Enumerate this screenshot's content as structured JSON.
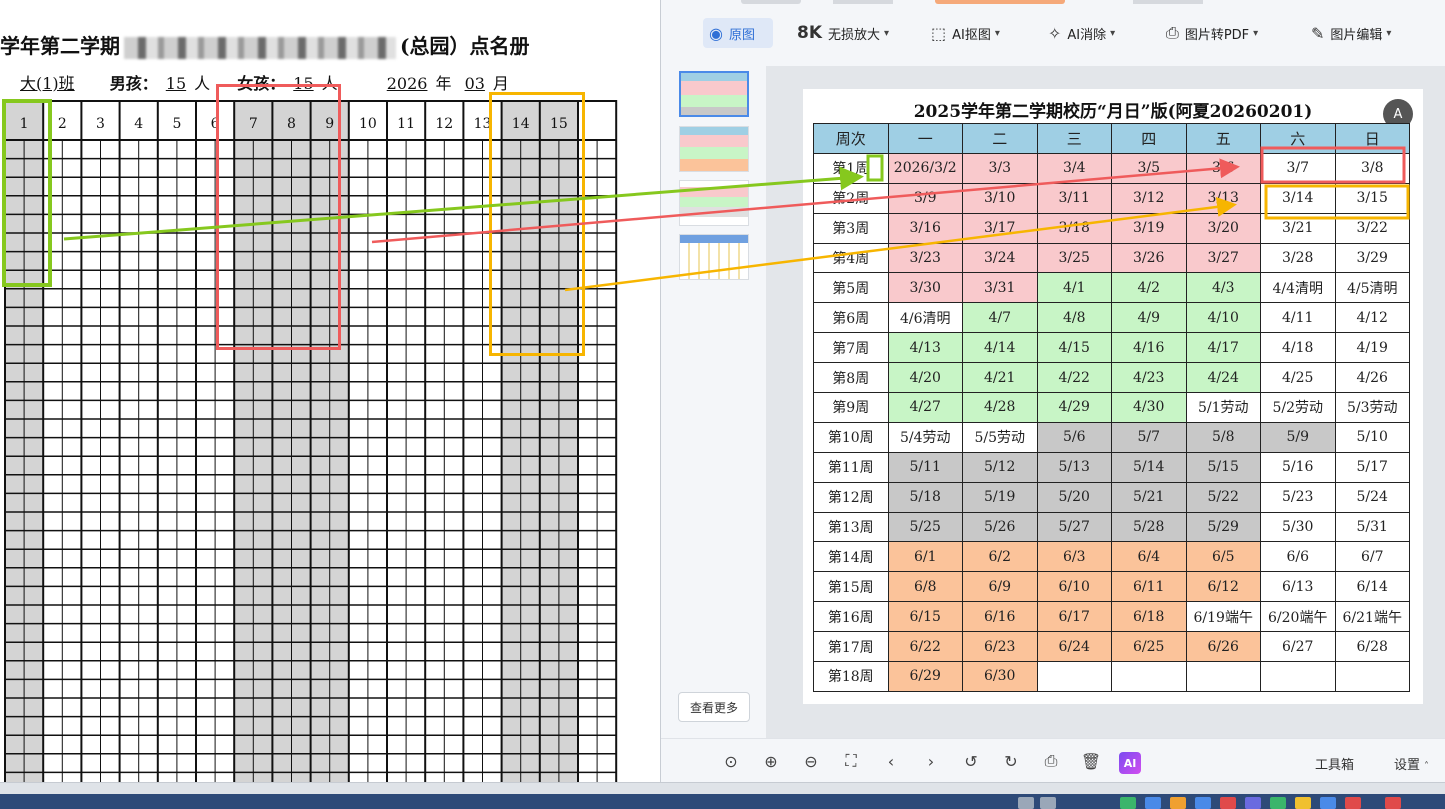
{
  "document": {
    "title_prefix": "学年第二学期",
    "title_suffix": "(总园）点名册",
    "class_name": "大(1)班",
    "boys_label": "男孩：",
    "boys_count": "15",
    "girls_label": "女孩：",
    "girls_count": "15",
    "person_unit": "人",
    "year": "2026",
    "year_unit": "年",
    "month": "03",
    "month_unit": "月",
    "day_headers": [
      "1",
      "2",
      "3",
      "4",
      "5",
      "6",
      "7",
      "8",
      "9",
      "10",
      "11",
      "12",
      "13",
      "14",
      "15"
    ],
    "shaded_columns": [
      1,
      7,
      8,
      9,
      14,
      15
    ],
    "highlight_colors": {
      "green": "#86c81e",
      "red": "#ef5b5b",
      "yellow": "#f7b500"
    }
  },
  "toolbar": {
    "original": "原图",
    "enlarge": "无损放大",
    "enlarge_icon_text": "8K",
    "cutout": "AI抠图",
    "erase": "AI消除",
    "to_pdf": "图片转PDF",
    "edit": "图片编辑"
  },
  "sidebar": {
    "more": "查看更多"
  },
  "calendar": {
    "title": "2025学年第二学期校历“月日”版(阿夏20260201)",
    "ocr_icon": "A",
    "headers": [
      "周次",
      "一",
      "二",
      "三",
      "四",
      "五",
      "六",
      "日"
    ],
    "rows": [
      {
        "week": "第1周",
        "cells": [
          {
            "t": "2026/3/2",
            "c": "pink"
          },
          {
            "t": "3/3",
            "c": "pink"
          },
          {
            "t": "3/4",
            "c": "pink"
          },
          {
            "t": "3/5",
            "c": "pink"
          },
          {
            "t": "3/6",
            "c": "pink"
          },
          {
            "t": "3/7",
            "c": "white"
          },
          {
            "t": "3/8",
            "c": "white"
          }
        ]
      },
      {
        "week": "第2周",
        "cells": [
          {
            "t": "3/9",
            "c": "pink"
          },
          {
            "t": "3/10",
            "c": "pink"
          },
          {
            "t": "3/11",
            "c": "pink"
          },
          {
            "t": "3/12",
            "c": "pink"
          },
          {
            "t": "3/13",
            "c": "pink"
          },
          {
            "t": "3/14",
            "c": "white"
          },
          {
            "t": "3/15",
            "c": "white"
          }
        ]
      },
      {
        "week": "第3周",
        "cells": [
          {
            "t": "3/16",
            "c": "pink"
          },
          {
            "t": "3/17",
            "c": "pink"
          },
          {
            "t": "3/18",
            "c": "pink"
          },
          {
            "t": "3/19",
            "c": "pink"
          },
          {
            "t": "3/20",
            "c": "pink"
          },
          {
            "t": "3/21",
            "c": "white"
          },
          {
            "t": "3/22",
            "c": "white"
          }
        ]
      },
      {
        "week": "第4周",
        "cells": [
          {
            "t": "3/23",
            "c": "pink"
          },
          {
            "t": "3/24",
            "c": "pink"
          },
          {
            "t": "3/25",
            "c": "pink"
          },
          {
            "t": "3/26",
            "c": "pink"
          },
          {
            "t": "3/27",
            "c": "pink"
          },
          {
            "t": "3/28",
            "c": "white"
          },
          {
            "t": "3/29",
            "c": "white"
          }
        ]
      },
      {
        "week": "第5周",
        "cells": [
          {
            "t": "3/30",
            "c": "pink"
          },
          {
            "t": "3/31",
            "c": "pink"
          },
          {
            "t": "4/1",
            "c": "green"
          },
          {
            "t": "4/2",
            "c": "green"
          },
          {
            "t": "4/3",
            "c": "green"
          },
          {
            "t": "4/4清明",
            "c": "white"
          },
          {
            "t": "4/5清明",
            "c": "white"
          }
        ]
      },
      {
        "week": "第6周",
        "cells": [
          {
            "t": "4/6清明",
            "c": "white"
          },
          {
            "t": "4/7",
            "c": "green"
          },
          {
            "t": "4/8",
            "c": "green"
          },
          {
            "t": "4/9",
            "c": "green"
          },
          {
            "t": "4/10",
            "c": "green"
          },
          {
            "t": "4/11",
            "c": "white"
          },
          {
            "t": "4/12",
            "c": "white"
          }
        ]
      },
      {
        "week": "第7周",
        "cells": [
          {
            "t": "4/13",
            "c": "green"
          },
          {
            "t": "4/14",
            "c": "green"
          },
          {
            "t": "4/15",
            "c": "green"
          },
          {
            "t": "4/16",
            "c": "green"
          },
          {
            "t": "4/17",
            "c": "green"
          },
          {
            "t": "4/18",
            "c": "white"
          },
          {
            "t": "4/19",
            "c": "white"
          }
        ]
      },
      {
        "week": "第8周",
        "cells": [
          {
            "t": "4/20",
            "c": "green"
          },
          {
            "t": "4/21",
            "c": "green"
          },
          {
            "t": "4/22",
            "c": "green"
          },
          {
            "t": "4/23",
            "c": "green"
          },
          {
            "t": "4/24",
            "c": "green"
          },
          {
            "t": "4/25",
            "c": "white"
          },
          {
            "t": "4/26",
            "c": "white"
          }
        ]
      },
      {
        "week": "第9周",
        "cells": [
          {
            "t": "4/27",
            "c": "green"
          },
          {
            "t": "4/28",
            "c": "green"
          },
          {
            "t": "4/29",
            "c": "green"
          },
          {
            "t": "4/30",
            "c": "green"
          },
          {
            "t": "5/1劳动",
            "c": "white"
          },
          {
            "t": "5/2劳动",
            "c": "white"
          },
          {
            "t": "5/3劳动",
            "c": "white"
          }
        ]
      },
      {
        "week": "第10周",
        "cells": [
          {
            "t": "5/4劳动",
            "c": "white"
          },
          {
            "t": "5/5劳动",
            "c": "white"
          },
          {
            "t": "5/6",
            "c": "gray"
          },
          {
            "t": "5/7",
            "c": "gray"
          },
          {
            "t": "5/8",
            "c": "gray"
          },
          {
            "t": "5/9",
            "c": "gray"
          },
          {
            "t": "5/10",
            "c": "white"
          }
        ]
      },
      {
        "week": "第11周",
        "cells": [
          {
            "t": "5/11",
            "c": "gray"
          },
          {
            "t": "5/12",
            "c": "gray"
          },
          {
            "t": "5/13",
            "c": "gray"
          },
          {
            "t": "5/14",
            "c": "gray"
          },
          {
            "t": "5/15",
            "c": "gray"
          },
          {
            "t": "5/16",
            "c": "white"
          },
          {
            "t": "5/17",
            "c": "white"
          }
        ]
      },
      {
        "week": "第12周",
        "cells": [
          {
            "t": "5/18",
            "c": "gray"
          },
          {
            "t": "5/19",
            "c": "gray"
          },
          {
            "t": "5/20",
            "c": "gray"
          },
          {
            "t": "5/21",
            "c": "gray"
          },
          {
            "t": "5/22",
            "c": "gray"
          },
          {
            "t": "5/23",
            "c": "white"
          },
          {
            "t": "5/24",
            "c": "white"
          }
        ]
      },
      {
        "week": "第13周",
        "cells": [
          {
            "t": "5/25",
            "c": "gray"
          },
          {
            "t": "5/26",
            "c": "gray"
          },
          {
            "t": "5/27",
            "c": "gray"
          },
          {
            "t": "5/28",
            "c": "gray"
          },
          {
            "t": "5/29",
            "c": "gray"
          },
          {
            "t": "5/30",
            "c": "white"
          },
          {
            "t": "5/31",
            "c": "white"
          }
        ]
      },
      {
        "week": "第14周",
        "cells": [
          {
            "t": "6/1",
            "c": "orange"
          },
          {
            "t": "6/2",
            "c": "orange"
          },
          {
            "t": "6/3",
            "c": "orange"
          },
          {
            "t": "6/4",
            "c": "orange"
          },
          {
            "t": "6/5",
            "c": "orange"
          },
          {
            "t": "6/6",
            "c": "white"
          },
          {
            "t": "6/7",
            "c": "white"
          }
        ]
      },
      {
        "week": "第15周",
        "cells": [
          {
            "t": "6/8",
            "c": "orange"
          },
          {
            "t": "6/9",
            "c": "orange"
          },
          {
            "t": "6/10",
            "c": "orange"
          },
          {
            "t": "6/11",
            "c": "orange"
          },
          {
            "t": "6/12",
            "c": "orange"
          },
          {
            "t": "6/13",
            "c": "white"
          },
          {
            "t": "6/14",
            "c": "white"
          }
        ]
      },
      {
        "week": "第16周",
        "cells": [
          {
            "t": "6/15",
            "c": "orange"
          },
          {
            "t": "6/16",
            "c": "orange"
          },
          {
            "t": "6/17",
            "c": "orange"
          },
          {
            "t": "6/18",
            "c": "orange"
          },
          {
            "t": "6/19端午",
            "c": "white"
          },
          {
            "t": "6/20端午",
            "c": "white"
          },
          {
            "t": "6/21端午",
            "c": "white"
          }
        ]
      },
      {
        "week": "第17周",
        "cells": [
          {
            "t": "6/22",
            "c": "orange"
          },
          {
            "t": "6/23",
            "c": "orange"
          },
          {
            "t": "6/24",
            "c": "orange"
          },
          {
            "t": "6/25",
            "c": "orange"
          },
          {
            "t": "6/26",
            "c": "orange"
          },
          {
            "t": "6/27",
            "c": "white"
          },
          {
            "t": "6/28",
            "c": "white"
          }
        ]
      },
      {
        "week": "第18周",
        "cells": [
          {
            "t": "6/29",
            "c": "orange"
          },
          {
            "t": "6/30",
            "c": "orange"
          },
          {
            "t": "",
            "c": "white"
          },
          {
            "t": "",
            "c": "white"
          },
          {
            "t": "",
            "c": "white"
          },
          {
            "t": "",
            "c": "white"
          },
          {
            "t": "",
            "c": "white"
          }
        ]
      }
    ]
  },
  "bottombar": {
    "ai": "AI",
    "tools": "工具箱",
    "settings": "设置"
  }
}
